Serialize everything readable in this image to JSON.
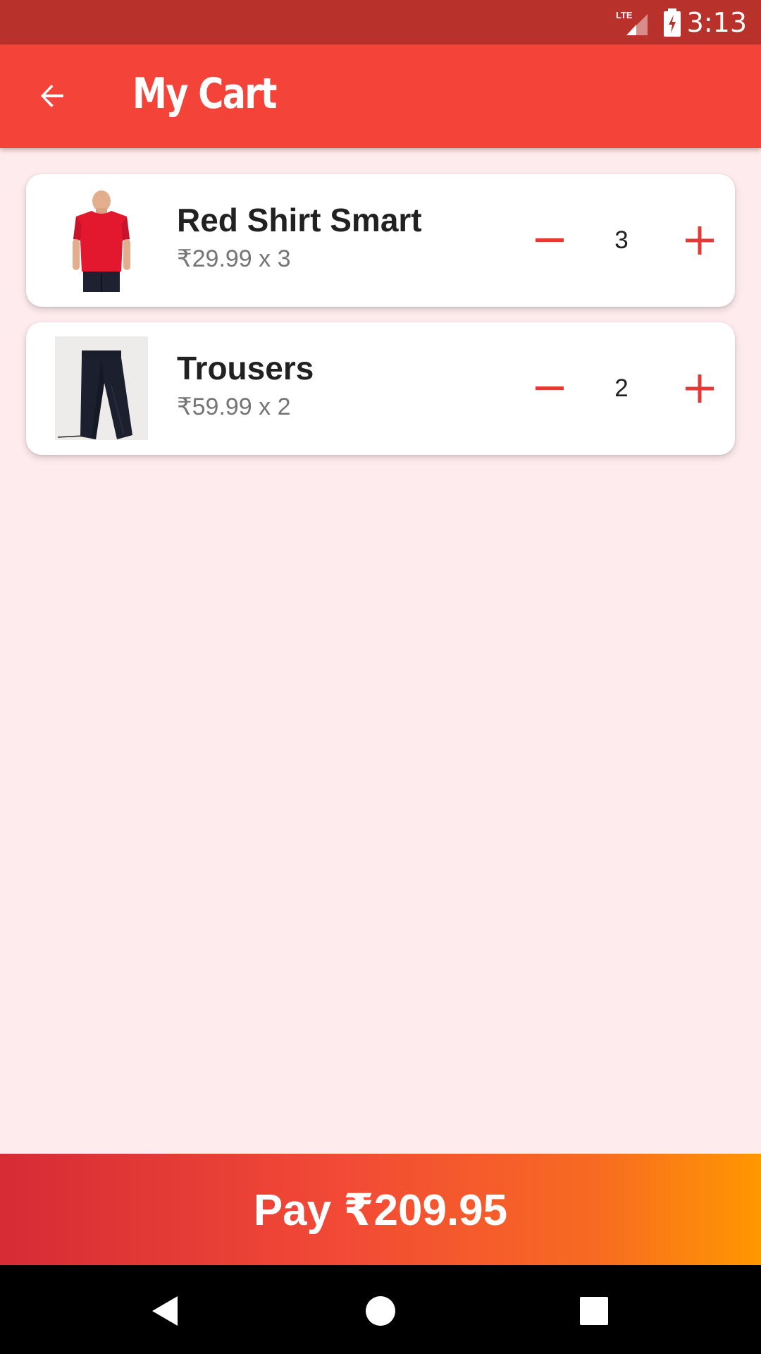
{
  "status_bar": {
    "time": "3:13",
    "network_label": "LTE",
    "icons": [
      "lte-signal-icon",
      "battery-charging-icon"
    ]
  },
  "app_bar": {
    "title": "My Cart",
    "back_icon": "arrow-back-icon"
  },
  "colors": {
    "status_bar": "#B8312B",
    "app_bar": "#F4443A",
    "background": "#FEEBEE",
    "accent": "#E53935",
    "pay_gradient_start": "#D62B35",
    "pay_gradient_end": "#FF9800"
  },
  "cart": {
    "items": [
      {
        "name": "Red Shirt Smart",
        "price": "₹29.99 x 3",
        "quantity": "3",
        "image": "red-tshirt-image",
        "minus_icon": "minus-icon",
        "plus_icon": "plus-icon"
      },
      {
        "name": "Trousers",
        "price": "₹59.99 x 2",
        "quantity": "2",
        "image": "trousers-image",
        "minus_icon": "minus-icon",
        "plus_icon": "plus-icon"
      }
    ]
  },
  "footer": {
    "pay_label": "Pay ₹209.95"
  },
  "nav_bar": {
    "icons": [
      "nav-back-icon",
      "nav-home-icon",
      "nav-recents-icon"
    ]
  }
}
